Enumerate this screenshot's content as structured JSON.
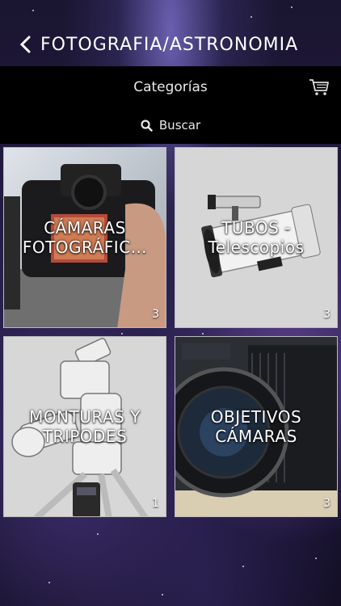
{
  "header": {
    "title": "FOTOGRAFIA/ASTRONOMIA"
  },
  "bar": {
    "title": "Categorías",
    "search_label": "Buscar"
  },
  "categories": [
    {
      "label": "CÁMARAS FOTOGRÁFIC…",
      "count": "3"
    },
    {
      "label": "TUBOS - Telescopios",
      "count": "3"
    },
    {
      "label": "MONTURAS Y TRIPODES",
      "count": "1"
    },
    {
      "label": "OBJETIVOS CÁMARAS",
      "count": "3"
    }
  ]
}
